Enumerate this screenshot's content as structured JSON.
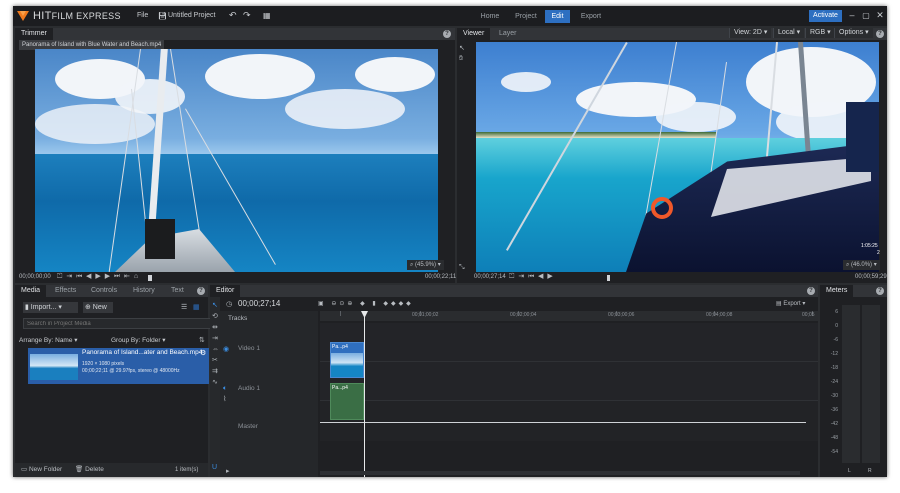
{
  "app": {
    "brand_hit": "HIT",
    "brand_film": "FILM EXPRESS",
    "menu_file": "File",
    "project_name": "Untitled Project",
    "nav": [
      "Home",
      "Project",
      "Edit",
      "Export"
    ],
    "activate": "Activate"
  },
  "trimmer": {
    "tab": "Trimmer",
    "clip_title": "Panorama of Island with Blue Water and Beach.mp4",
    "time_start": "00;00;00;00",
    "time_end": "00;00;22;11",
    "zoom": "(45.9%)"
  },
  "viewer": {
    "tabs": [
      "Viewer",
      "Layer"
    ],
    "view_mode": "View: 2D",
    "space": "Local",
    "channel": "RGB",
    "options": "Options",
    "time_start": "00;00;27;14",
    "time_end": "00;00;59;29",
    "zoom": "(46.0%)",
    "overlay_a": "1:05:25",
    "overlay_b": "2"
  },
  "media": {
    "tabs": [
      "Media",
      "Effects",
      "Controls",
      "History",
      "Text"
    ],
    "import_label": "Import...",
    "new_label": "New",
    "search_placeholder": "Search in Project Media",
    "arrange_label": "Arrange By: Name",
    "group_label": "Group By: Folder",
    "item_title": "Panorama of Island...ater and Beach.mp4",
    "item_res": "1920 × 1080 pixels",
    "item_info": "00;00;22;11 @ 29.97fps, stereo @ 48000Hz",
    "new_folder": "New Folder",
    "delete": "Delete",
    "count": "1 item(s)"
  },
  "editor": {
    "tab": "Editor",
    "timecode": "00;00;27;14",
    "export": "Export",
    "tracks_label": "Tracks",
    "ruler": [
      "00;01;00;02",
      "00;02;00;04",
      "00;03;00;06",
      "00;04;00;08",
      "00;05"
    ],
    "video_track": "Video 1",
    "audio_track": "Audio 1",
    "master_track": "Master",
    "video_clip": "Pa...p4",
    "audio_clip": "Pa...p4"
  },
  "meters": {
    "tab": "Meters",
    "scale": [
      "6",
      "0",
      "-6",
      "-12",
      "-18",
      "-24",
      "-30",
      "-36",
      "-42",
      "-48",
      "-54"
    ],
    "channels": [
      "L",
      "R"
    ]
  },
  "colors": {
    "accent": "#2d6fc1",
    "panel": "#1f2023",
    "header": "#323438",
    "video_clip": "#2f6fbf",
    "audio_clip": "#3a6e45"
  }
}
